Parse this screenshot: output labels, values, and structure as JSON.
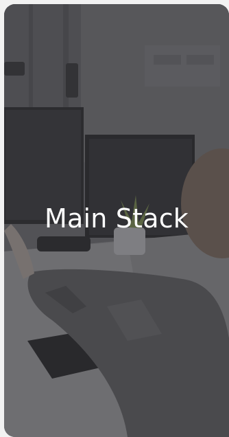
{
  "screen": {
    "title": "Main Stack"
  },
  "background": {
    "image": "office-worker-at-desk-photo",
    "overlay_color": "#28282c"
  }
}
